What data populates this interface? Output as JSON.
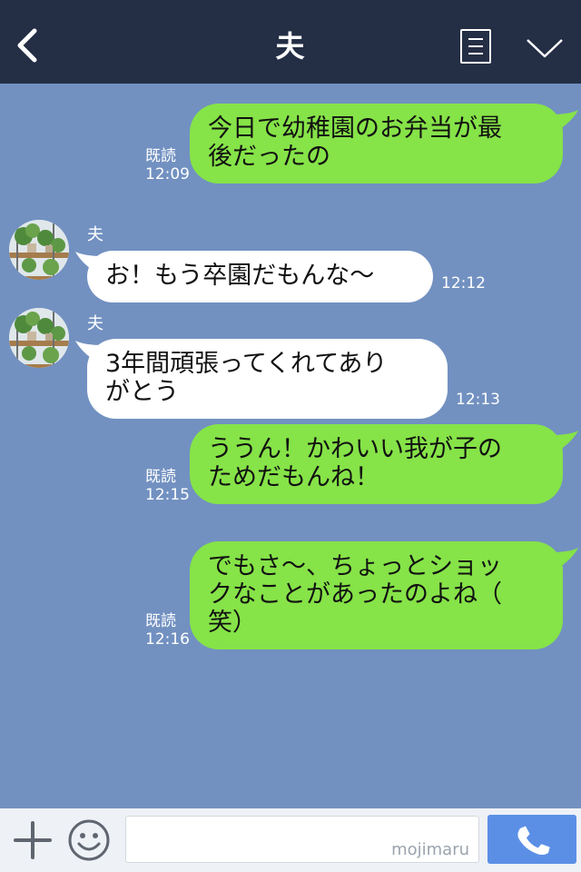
{
  "header": {
    "title": "夫",
    "back_icon": "chevron-left-icon",
    "notes_icon": "notes-icon",
    "menu_icon": "chevron-down-icon"
  },
  "messages": [
    {
      "from": "me",
      "text": "今日で幼稚園のお弁当が最\n後だったの",
      "read": "既読",
      "time": "12:09"
    },
    {
      "from": "them",
      "sender": "夫",
      "text": "お！もう卒園だもんな〜",
      "time": "12:12"
    },
    {
      "from": "them",
      "sender": "夫",
      "text": "3年間頑張ってくれてあり\nがとう",
      "time": "12:13"
    },
    {
      "from": "me",
      "text": "ううん！かわいい我が子の\nためだもんね！",
      "read": "既読",
      "time": "12:15"
    },
    {
      "from": "me",
      "text": "でもさ〜、ちょっとショッ\nクなことがあったのよね（\n笑）",
      "read": "既読",
      "time": "12:16"
    }
  ],
  "footer": {
    "input_value": "",
    "watermark": "mojimaru",
    "icons": [
      "plus-icon",
      "smile-icon",
      "phone-icon"
    ]
  },
  "colors": {
    "header_bg": "#242e45",
    "chat_bg": "#7291c1",
    "my_bubble": "#86e348",
    "their_bubble": "#ffffff",
    "call_button": "#5b8fe6"
  }
}
